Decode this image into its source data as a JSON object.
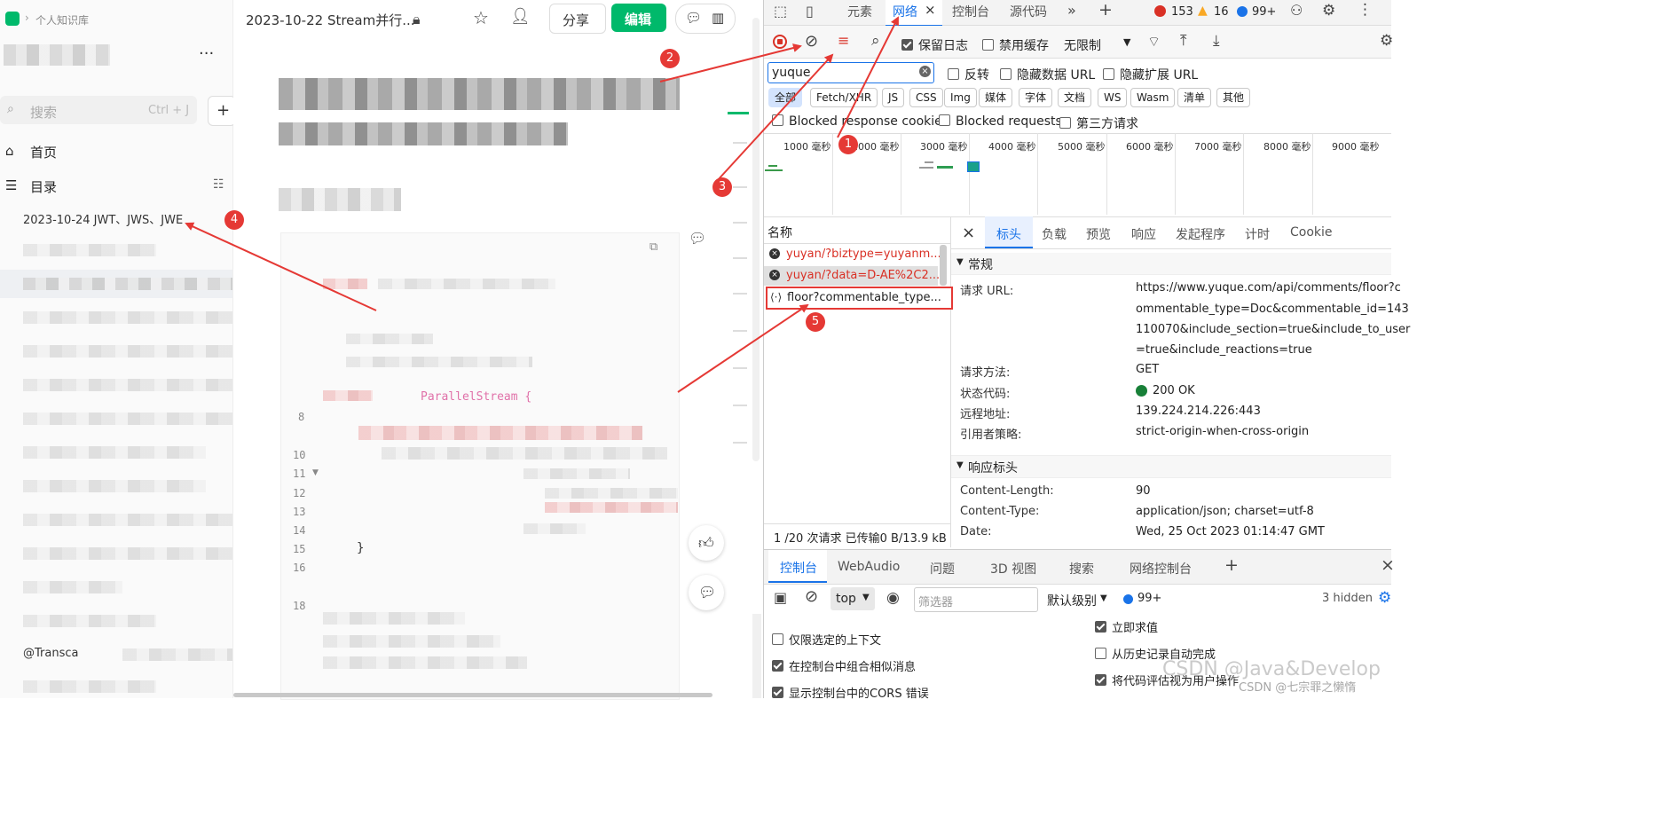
{
  "sidebar": {
    "breadcrumb": "个人知识库",
    "search_placeholder": "搜索",
    "search_shortcut": "Ctrl + J",
    "home_label": "首页",
    "toc_label": "目录",
    "doc_item": "2023-10-24 JWT、JWS、JWE",
    "footer_item": "@Transca"
  },
  "editor": {
    "doc_title": "2023-10-22 Stream并行...",
    "share_label": "分享",
    "edit_label": "编辑",
    "line_numbers": [
      "8",
      "10",
      "11",
      "12",
      "13",
      "14",
      "15",
      "16",
      "18"
    ],
    "code_snippet": "ParallelStream {",
    "closing_brace": "}"
  },
  "devtools": {
    "tabs": [
      "元素",
      "网络",
      "控制台",
      "源代码"
    ],
    "error_count": "153",
    "warning_count": "16",
    "info_count": "99+",
    "preserve_log": "保留日志",
    "disable_cache": "禁用缓存",
    "throttle": "无限制",
    "filter_value": "yuque",
    "invert": "反转",
    "hide_data_url": "隐藏数据 URL",
    "hide_ext_url": "隐藏扩展 URL",
    "type_filters": [
      "全部",
      "Fetch/XHR",
      "JS",
      "CSS",
      "Img",
      "媒体",
      "字体",
      "文档",
      "WS",
      "Wasm",
      "清单",
      "其他"
    ],
    "blocked_cookies": "Blocked response cookies",
    "blocked_requests": "Blocked requests",
    "third_party": "第三方请求",
    "timeline_labels": [
      "1000 毫秒",
      "2000 毫秒",
      "3000 毫秒",
      "4000 毫秒",
      "5000 毫秒",
      "6000 毫秒",
      "7000 毫秒",
      "8000 毫秒",
      "9000 毫秒"
    ],
    "name_header": "名称",
    "requests": [
      {
        "name": "yuyan/?biztype=yuyanm...",
        "status": "error"
      },
      {
        "name": "yuyan/?data=D-AE%2C2...",
        "status": "error"
      },
      {
        "name": "floor?commentable_type...",
        "status": "ok"
      }
    ],
    "summary": "1 /20 次请求  已传输0 B/13.9 kB",
    "detail_tabs": [
      "标头",
      "负载",
      "预览",
      "响应",
      "发起程序",
      "计时",
      "Cookie"
    ],
    "general_title": "常规",
    "general": [
      {
        "key": "请求 URL:",
        "lines": [
          "https://www.yuque.com/api/comments/floor?c",
          "ommentable_type=Doc&commentable_id=143",
          "110070&include_section=true&include_to_user",
          "=true&include_reactions=true"
        ]
      },
      {
        "key": "请求方法:",
        "lines": [
          "GET"
        ]
      },
      {
        "key": "状态代码:",
        "lines": [
          "200 OK"
        ]
      },
      {
        "key": "远程地址:",
        "lines": [
          "139.224.214.226:443"
        ]
      },
      {
        "key": "引用者策略:",
        "lines": [
          "strict-origin-when-cross-origin"
        ]
      }
    ],
    "response_headers_title": "响应标头",
    "response_headers": [
      {
        "key": "Content-Length:",
        "value": "90"
      },
      {
        "key": "Content-Type:",
        "value": "application/json; charset=utf-8"
      },
      {
        "key": "Date:",
        "value": "Wed, 25 Oct 2023 01:14:47 GMT"
      }
    ],
    "drawer_tabs": [
      "控制台",
      "WebAudio",
      "问题",
      "3D 视图",
      "搜索",
      "网络控制台"
    ],
    "context": "top",
    "console_filter_placeholder": "筛选器",
    "default_levels": "默认级别",
    "console_info_count": "99+",
    "hidden_count": "3 hidden",
    "console_options_left": [
      "仅限选定的上下文",
      "在控制台中组合相似消息",
      "显示控制台中的CORS 错误"
    ],
    "console_options_right": [
      "立即求值",
      "从历史记录自动完成",
      "将代码评估视为用户操作"
    ],
    "watermark": "CSDN @Java&Develop",
    "watermark2": "CSDN @七宗罪之懒惰"
  },
  "annotations": [
    "1",
    "2",
    "3",
    "4",
    "5"
  ],
  "colors": {
    "accent": "#1a73e8",
    "edit_green": "#00b96b",
    "annotation_red": "#e53935",
    "error_red": "#d93025"
  }
}
